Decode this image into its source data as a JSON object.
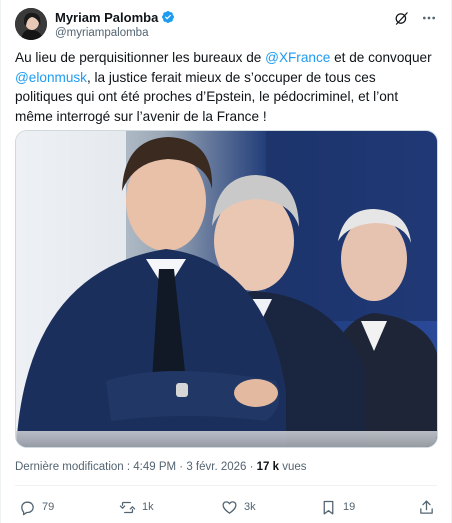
{
  "author": {
    "display_name": "Myriam Palomba",
    "handle": "@myriampalomba",
    "verified": true,
    "avatar_icon": "avatar-photo",
    "verified_icon": "verified-badge-icon"
  },
  "header_actions": {
    "grok_icon": "grok-icon",
    "more_icon": "more-options-icon"
  },
  "tweet": {
    "text_part1": "Au lieu de perquisitionner les bureaux de ",
    "mention1": "@XFrance",
    "text_part2": " et de convoquer ",
    "mention2": "@elonmusk",
    "text_part3": ", la justice ferait mieux de s’occuper de tous ces politiques qui ont été proches d’Epstein, le pédocriminel, et l’ont même interrogé sur l’avenir de la France !"
  },
  "meta": {
    "label": "Dernière modification : ",
    "time": "4:49 PM",
    "separator1": " · ",
    "date": "3 févr. 2026",
    "separator2": " · ",
    "views_count": "17 k",
    "views_label": " vues"
  },
  "actions": {
    "replies": "79",
    "reposts": "1k",
    "likes": "3k",
    "bookmarks": "19"
  },
  "colors": {
    "accent": "#1d9bf0",
    "text": "#0f1419",
    "secondary": "#536471"
  }
}
